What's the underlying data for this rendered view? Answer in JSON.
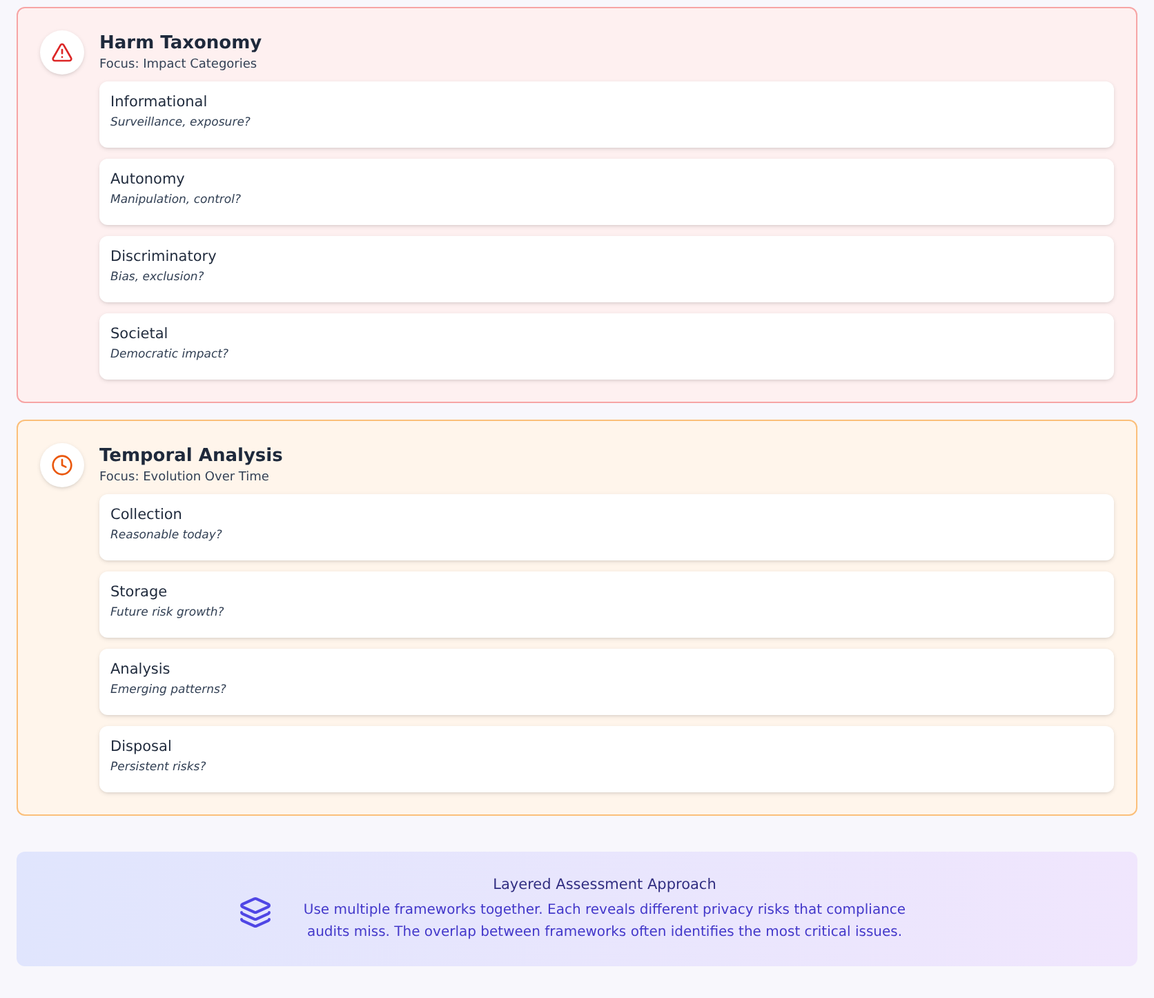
{
  "frameworks": [
    {
      "kind": "harm",
      "title": "Harm Taxonomy",
      "focus": "Focus: Impact Categories",
      "items": [
        {
          "name": "Informational",
          "question": "Surveillance, exposure?"
        },
        {
          "name": "Autonomy",
          "question": "Manipulation, control?"
        },
        {
          "name": "Discriminatory",
          "question": "Bias, exclusion?"
        },
        {
          "name": "Societal",
          "question": "Democratic impact?"
        }
      ]
    },
    {
      "kind": "temporal",
      "title": "Temporal Analysis",
      "focus": "Focus: Evolution Over Time",
      "items": [
        {
          "name": "Collection",
          "question": "Reasonable today?"
        },
        {
          "name": "Storage",
          "question": "Future risk growth?"
        },
        {
          "name": "Analysis",
          "question": "Emerging patterns?"
        },
        {
          "name": "Disposal",
          "question": "Persistent risks?"
        }
      ]
    }
  ],
  "callout": {
    "title": "Layered Assessment Approach",
    "text": "Use multiple frameworks together. Each reveals different privacy risks that compliance audits miss. The overlap between frameworks often identifies the most critical issues."
  }
}
